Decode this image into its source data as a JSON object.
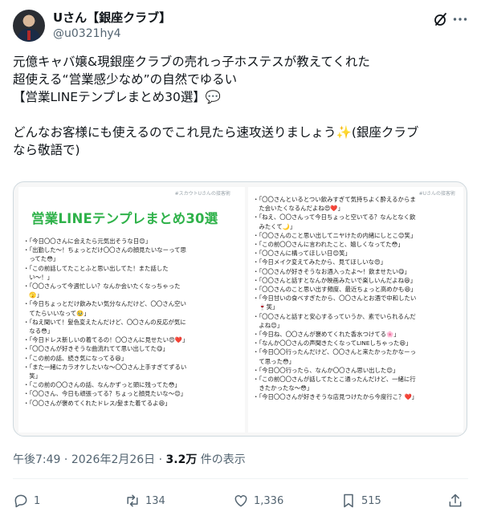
{
  "header": {
    "display_name": "Uさん【銀座クラブ】",
    "handle": "@u0321hy4",
    "grok_icon": "grok-icon",
    "more_icon": "more-horizontal-icon"
  },
  "tweet": {
    "lines": [
      "元億キャバ嬢&現銀座クラブの売れっ子ホステスが教えてくれた",
      "超使える“営業感少なめ”の自然でゆるい",
      "【営業LINEテンプレまとめ30選】💬",
      "",
      "どんなお客様にも使えるのでこれ見たら速攻送りましょう✨(銀座クラブ",
      "なら敬語で)"
    ]
  },
  "media": {
    "watermark_left": "#スカウトUさんの接客術",
    "watermark_right": "#Uさんの接客術",
    "title": "営業LINEテンプレまとめ30選",
    "left_items": [
      "・「今日〇〇さんに会えたら元気出そうな日😊」",
      "・「出勤した〜！ちょっとだけ〇〇さんの顔見たいなーって思",
      "　ってた😳」",
      "・「この前話してたことふと思い出してた！また話した",
      "　い〜！」",
      "・「〇〇さんって今週忙しい？なんか会いたくなっちゃった",
      "　🫣」",
      "・「今日ちょっとだけ飲みたい気分なんだけど、〇〇さん空い",
      "　てたらいいなって🥹」",
      "・「ねえ聞いて！髪色変えたんだけど、〇〇さんの反応が気に",
      "　なる😳」",
      "・「今日ドレス新しいの着てるの！〇〇さんに見せたい😍❤️」",
      "・「〇〇さんが好きそうな曲流れてて思い出してた😋」",
      "・「この前の話、続き気になってる😆」",
      "・「また一緒にカラオケしたいな〜〇〇さん上手すぎてずるい",
      "　笑」",
      "・「この前の〇〇さんの話、なんかずっと頭に残ってた😳」",
      "・「〇〇さん、今日も頑張ってる？ちょっと顔見たいな〜😊」",
      "・「〇〇さんが褒めてくれたドレス/髪また着てるよ😆」"
    ],
    "right_items": [
      "・「〇〇さんといるとつい飲みすぎて気持ちよく酔えるからま",
      "　た会いたくなるんだよね😍❤️」",
      "・「ねえ、〇〇さんって今日ちょっと空いてる？なんとなく飲",
      "　みたくて🌙」",
      "・「〇〇さんのこと思い出してニヤけたの内緒にしとこ😊笑」",
      "・「この前〇〇さんに言われたこと、嬉しくなってた😳」",
      "・「〇〇さんに構ってほしい日😊笑」",
      "・「今日メイク変えてみたから、見てほしいな😍」",
      "・「〇〇さんが好きそうなお酒入ったよ〜！飲ませたい😋」",
      "・「〇〇さんと話すとなんか映画みたいで楽しいんだよね😆」",
      "・「〇〇さんのこと思い出す頻度、最近ちょっと高めかも😆」",
      "・「今日甘いの食べすぎたから、〇〇さんとお酒で中和したい",
      "　🍷笑」",
      "・「〇〇さんと話すと安心するっていうか、素でいられるんだ",
      "　よね😊」",
      "・「今日ね、〇〇さんが褒めてくれた香水つけてる🌸」",
      "・「なんか〇〇さんの声聞きたくなってLINEしちゃった😆」",
      "・「今日〇〇行ったんだけど、〇〇さんと来たかったかなーっ",
      "　て思った😳」",
      "・「今日〇〇行ったら、なんか〇〇さん思い出した😊」",
      "・「この前〇〇さんが話してたとこ通ったんだけど、一緒に行",
      "　きたかったな〜😳」",
      "・「今日〇〇さんが好きそうな店見つけたから今度行こ？❤️」"
    ]
  },
  "meta": {
    "time": "午後7:49",
    "dot": "·",
    "date": "2026年2月26日",
    "views_count": "3.2万",
    "views_label": "件の表示"
  },
  "actions": {
    "reply_count": "1",
    "retweet_count": "134",
    "like_count": "1,336",
    "bookmark_count": "515",
    "icons": [
      "reply-icon",
      "retweet-icon",
      "heart-icon",
      "bookmark-icon",
      "share-icon"
    ]
  }
}
